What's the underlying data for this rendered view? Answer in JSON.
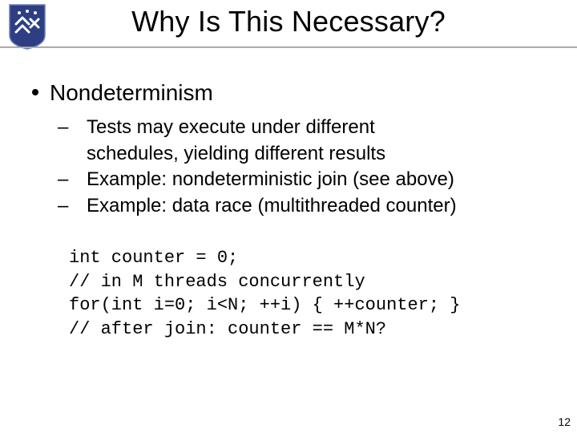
{
  "title": "Why Is This Necessary?",
  "pageNumber": "12",
  "bullet1": "Nondeterminism",
  "sub1a": "Tests may execute under different",
  "sub1b": "schedules, yielding different results",
  "sub2": "Example: nondeterministic join (see above)",
  "sub3": "Example: data race (multithreaded counter)",
  "code1": "int counter = 0;",
  "code2": "// in M threads concurrently",
  "code3": "for(int i=0; i<N; ++i) { ++counter; }",
  "code4": "// after join: counter == M*N?"
}
